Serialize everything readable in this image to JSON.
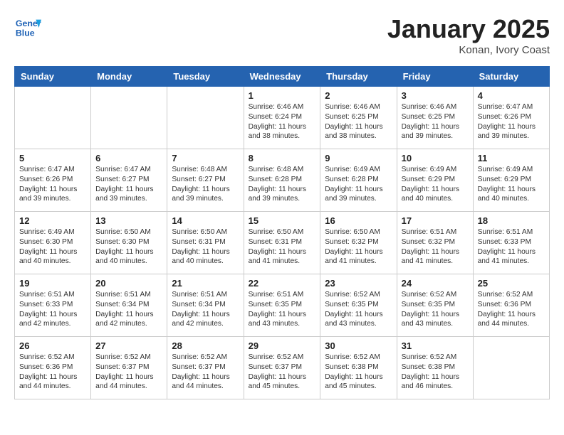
{
  "header": {
    "logo_line1": "General",
    "logo_line2": "Blue",
    "month": "January 2025",
    "location": "Konan, Ivory Coast"
  },
  "weekdays": [
    "Sunday",
    "Monday",
    "Tuesday",
    "Wednesday",
    "Thursday",
    "Friday",
    "Saturday"
  ],
  "weeks": [
    [
      {
        "day": "",
        "sunrise": "",
        "sunset": "",
        "daylight": ""
      },
      {
        "day": "",
        "sunrise": "",
        "sunset": "",
        "daylight": ""
      },
      {
        "day": "",
        "sunrise": "",
        "sunset": "",
        "daylight": ""
      },
      {
        "day": "1",
        "sunrise": "Sunrise: 6:46 AM",
        "sunset": "Sunset: 6:24 PM",
        "daylight": "Daylight: 11 hours and 38 minutes."
      },
      {
        "day": "2",
        "sunrise": "Sunrise: 6:46 AM",
        "sunset": "Sunset: 6:25 PM",
        "daylight": "Daylight: 11 hours and 38 minutes."
      },
      {
        "day": "3",
        "sunrise": "Sunrise: 6:46 AM",
        "sunset": "Sunset: 6:25 PM",
        "daylight": "Daylight: 11 hours and 39 minutes."
      },
      {
        "day": "4",
        "sunrise": "Sunrise: 6:47 AM",
        "sunset": "Sunset: 6:26 PM",
        "daylight": "Daylight: 11 hours and 39 minutes."
      }
    ],
    [
      {
        "day": "5",
        "sunrise": "Sunrise: 6:47 AM",
        "sunset": "Sunset: 6:26 PM",
        "daylight": "Daylight: 11 hours and 39 minutes."
      },
      {
        "day": "6",
        "sunrise": "Sunrise: 6:47 AM",
        "sunset": "Sunset: 6:27 PM",
        "daylight": "Daylight: 11 hours and 39 minutes."
      },
      {
        "day": "7",
        "sunrise": "Sunrise: 6:48 AM",
        "sunset": "Sunset: 6:27 PM",
        "daylight": "Daylight: 11 hours and 39 minutes."
      },
      {
        "day": "8",
        "sunrise": "Sunrise: 6:48 AM",
        "sunset": "Sunset: 6:28 PM",
        "daylight": "Daylight: 11 hours and 39 minutes."
      },
      {
        "day": "9",
        "sunrise": "Sunrise: 6:49 AM",
        "sunset": "Sunset: 6:28 PM",
        "daylight": "Daylight: 11 hours and 39 minutes."
      },
      {
        "day": "10",
        "sunrise": "Sunrise: 6:49 AM",
        "sunset": "Sunset: 6:29 PM",
        "daylight": "Daylight: 11 hours and 40 minutes."
      },
      {
        "day": "11",
        "sunrise": "Sunrise: 6:49 AM",
        "sunset": "Sunset: 6:29 PM",
        "daylight": "Daylight: 11 hours and 40 minutes."
      }
    ],
    [
      {
        "day": "12",
        "sunrise": "Sunrise: 6:49 AM",
        "sunset": "Sunset: 6:30 PM",
        "daylight": "Daylight: 11 hours and 40 minutes."
      },
      {
        "day": "13",
        "sunrise": "Sunrise: 6:50 AM",
        "sunset": "Sunset: 6:30 PM",
        "daylight": "Daylight: 11 hours and 40 minutes."
      },
      {
        "day": "14",
        "sunrise": "Sunrise: 6:50 AM",
        "sunset": "Sunset: 6:31 PM",
        "daylight": "Daylight: 11 hours and 40 minutes."
      },
      {
        "day": "15",
        "sunrise": "Sunrise: 6:50 AM",
        "sunset": "Sunset: 6:31 PM",
        "daylight": "Daylight: 11 hours and 41 minutes."
      },
      {
        "day": "16",
        "sunrise": "Sunrise: 6:50 AM",
        "sunset": "Sunset: 6:32 PM",
        "daylight": "Daylight: 11 hours and 41 minutes."
      },
      {
        "day": "17",
        "sunrise": "Sunrise: 6:51 AM",
        "sunset": "Sunset: 6:32 PM",
        "daylight": "Daylight: 11 hours and 41 minutes."
      },
      {
        "day": "18",
        "sunrise": "Sunrise: 6:51 AM",
        "sunset": "Sunset: 6:33 PM",
        "daylight": "Daylight: 11 hours and 41 minutes."
      }
    ],
    [
      {
        "day": "19",
        "sunrise": "Sunrise: 6:51 AM",
        "sunset": "Sunset: 6:33 PM",
        "daylight": "Daylight: 11 hours and 42 minutes."
      },
      {
        "day": "20",
        "sunrise": "Sunrise: 6:51 AM",
        "sunset": "Sunset: 6:34 PM",
        "daylight": "Daylight: 11 hours and 42 minutes."
      },
      {
        "day": "21",
        "sunrise": "Sunrise: 6:51 AM",
        "sunset": "Sunset: 6:34 PM",
        "daylight": "Daylight: 11 hours and 42 minutes."
      },
      {
        "day": "22",
        "sunrise": "Sunrise: 6:51 AM",
        "sunset": "Sunset: 6:35 PM",
        "daylight": "Daylight: 11 hours and 43 minutes."
      },
      {
        "day": "23",
        "sunrise": "Sunrise: 6:52 AM",
        "sunset": "Sunset: 6:35 PM",
        "daylight": "Daylight: 11 hours and 43 minutes."
      },
      {
        "day": "24",
        "sunrise": "Sunrise: 6:52 AM",
        "sunset": "Sunset: 6:35 PM",
        "daylight": "Daylight: 11 hours and 43 minutes."
      },
      {
        "day": "25",
        "sunrise": "Sunrise: 6:52 AM",
        "sunset": "Sunset: 6:36 PM",
        "daylight": "Daylight: 11 hours and 44 minutes."
      }
    ],
    [
      {
        "day": "26",
        "sunrise": "Sunrise: 6:52 AM",
        "sunset": "Sunset: 6:36 PM",
        "daylight": "Daylight: 11 hours and 44 minutes."
      },
      {
        "day": "27",
        "sunrise": "Sunrise: 6:52 AM",
        "sunset": "Sunset: 6:37 PM",
        "daylight": "Daylight: 11 hours and 44 minutes."
      },
      {
        "day": "28",
        "sunrise": "Sunrise: 6:52 AM",
        "sunset": "Sunset: 6:37 PM",
        "daylight": "Daylight: 11 hours and 44 minutes."
      },
      {
        "day": "29",
        "sunrise": "Sunrise: 6:52 AM",
        "sunset": "Sunset: 6:37 PM",
        "daylight": "Daylight: 11 hours and 45 minutes."
      },
      {
        "day": "30",
        "sunrise": "Sunrise: 6:52 AM",
        "sunset": "Sunset: 6:38 PM",
        "daylight": "Daylight: 11 hours and 45 minutes."
      },
      {
        "day": "31",
        "sunrise": "Sunrise: 6:52 AM",
        "sunset": "Sunset: 6:38 PM",
        "daylight": "Daylight: 11 hours and 46 minutes."
      },
      {
        "day": "",
        "sunrise": "",
        "sunset": "",
        "daylight": ""
      }
    ]
  ]
}
